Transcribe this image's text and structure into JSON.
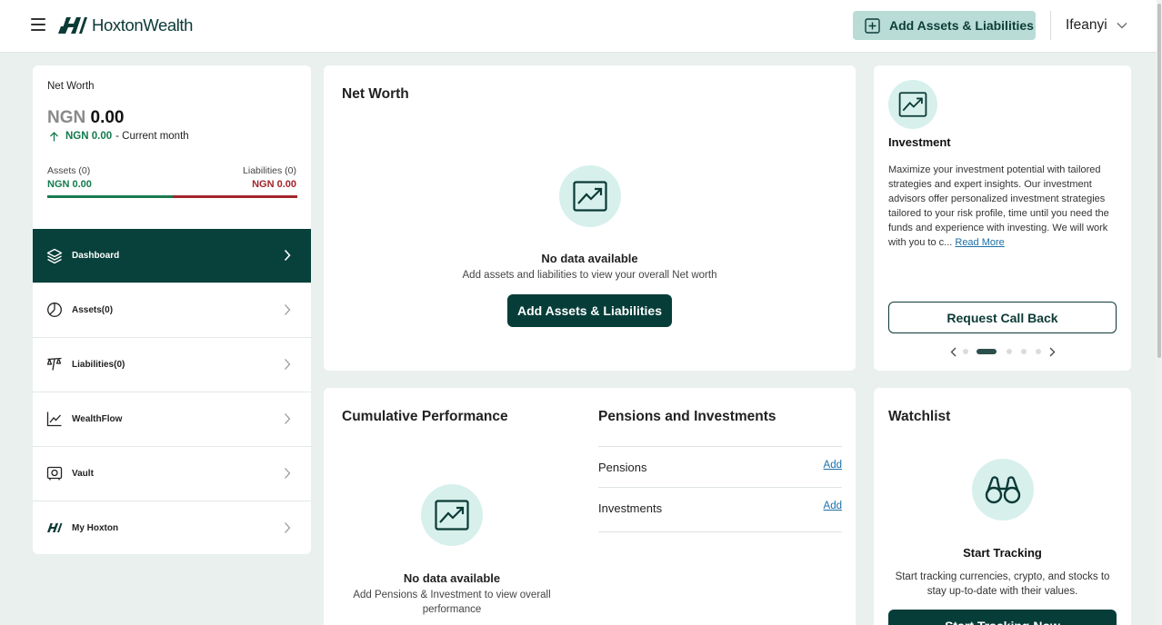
{
  "header": {
    "brand": "HoxtonWealth",
    "add_button": "Add Assets & Liabilities",
    "user_name": "Ifeanyi"
  },
  "net_worth_summary": {
    "label": "Net Worth",
    "currency": "NGN",
    "amount": "0.00",
    "change_value": "NGN 0.00",
    "change_period": "- Current month",
    "assets_label": "Assets (0)",
    "assets_value": "NGN 0.00",
    "liabilities_label": "Liabilities (0)",
    "liabilities_value": "NGN 0.00",
    "assets_color": "#127a4d",
    "liabilities_color": "#a3242a"
  },
  "sidebar": {
    "items": [
      {
        "label": "Dashboard",
        "icon": "layers-icon",
        "active": true
      },
      {
        "label": "Assets(0)",
        "icon": "pie-chart-icon",
        "active": false
      },
      {
        "label": "Liabilities(0)",
        "icon": "scale-icon",
        "active": false
      },
      {
        "label": "WealthFlow",
        "icon": "trend-chart-icon",
        "active": false
      },
      {
        "label": "Vault",
        "icon": "vault-icon",
        "active": false
      },
      {
        "label": "My Hoxton",
        "icon": "hoxton-logo-icon",
        "active": false
      }
    ]
  },
  "net_worth_card": {
    "title": "Net Worth",
    "empty_title": "No data available",
    "empty_subtitle": "Add assets and liabilities to view your overall Net worth",
    "button": "Add Assets & Liabilities"
  },
  "investment_card": {
    "title": "Investment",
    "description": "Maximize your investment potential with tailored strategies and expert insights. Our investment advisors offer personalized investment strategies tailored to your risk profile, time until you need the funds and experience with investing. We will work with you to c...",
    "read_more": "Read More",
    "button": "Request Call Back",
    "carousel_active_index": 1,
    "carousel_count": 5
  },
  "performance_card": {
    "title": "Cumulative Performance",
    "empty_title": "No data available",
    "empty_subtitle": "Add Pensions & Investment to view overall performance"
  },
  "pensions_investments": {
    "title": "Pensions and Investments",
    "rows": [
      {
        "name": "Pensions",
        "action": "Add"
      },
      {
        "name": "Investments",
        "action": "Add"
      }
    ]
  },
  "watchlist": {
    "title": "Watchlist",
    "heading": "Start Tracking",
    "description": "Start tracking currencies, crypto, and stocks to stay up-to-date with their values.",
    "button": "Start Tracking Now"
  },
  "colors": {
    "brand_dark": "#063d38",
    "accent_light": "#d7f0ec",
    "page_background": "#e9f0ee"
  }
}
